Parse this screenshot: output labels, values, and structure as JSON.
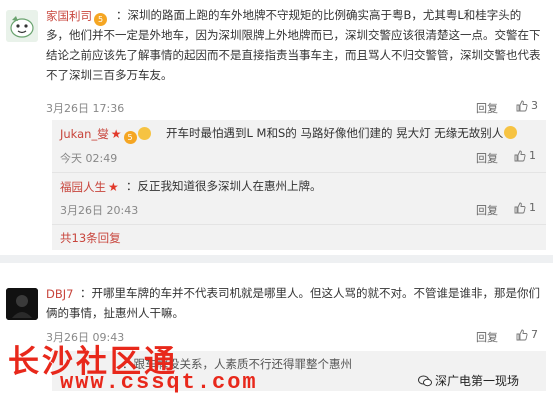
{
  "comment1": {
    "username": "家国利司",
    "badge_text": "5",
    "text_lines": [
      "：深圳的路面上跑的车外地牌不守规矩的比例确实高于粤B，尤其粤L和桂字头的",
      "多，他们并不一定是外地车，因为深圳限牌上外地牌而已，深圳交警应该很清楚这一点。交警在下",
      "结论之前应该先了解事情的起因而不是直接指责当事车主，而且骂人不归交警管，深圳交警也代表",
      "不了深圳三百多万车友。"
    ],
    "time": "3月26日 17:36",
    "reply_label": "回复",
    "likes": "3"
  },
  "reply1": {
    "username": "Jukan_燮",
    "text": "开车时最怕遇到L M和S的 马路好像他们建的 晃大灯 无缘无故别人",
    "time": "今天 02:49",
    "reply_label": "回复",
    "likes": "1"
  },
  "reply2": {
    "username": "福园人生",
    "text": "：反正我知道很多深圳人在惠州上牌。",
    "time": "3月26日 20:43",
    "reply_label": "回复",
    "likes": "1"
  },
  "more_replies": "共13条回复",
  "comment2": {
    "username": "DBJ7",
    "text_lines": [
      "：开哪里车牌的车并不代表司机就是哪里人。但这人骂的就不对。不管谁是谁非，那是你们",
      "俩的事情，扯惠州人干嘛。"
    ],
    "time": "3月26日 09:43",
    "reply_label": "回复",
    "likes": "7",
    "nested_text": "：跟车牌没关系，人素质不行还得罪整个惠州"
  },
  "watermark": {
    "title": "长沙社区通",
    "url": "www.cssqt.com"
  },
  "wechat": {
    "label": "深广电第一现场"
  },
  "colors": {
    "username": "#c8453c",
    "reply_box": "#f2f2f2",
    "separator": "#eef0f2",
    "watermark": "#e8281b"
  }
}
